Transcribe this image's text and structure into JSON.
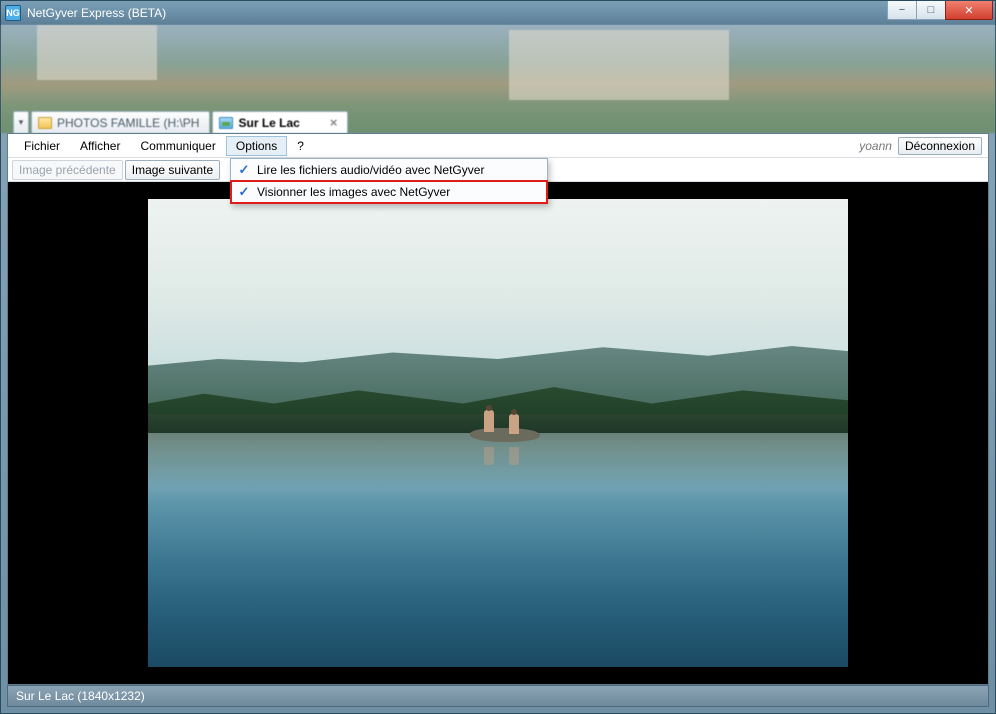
{
  "window": {
    "title": "NetGyver Express (BETA)",
    "app_icon_text": "NG"
  },
  "tabs": {
    "dropdown_glyph": "▾",
    "items": [
      {
        "label": "PHOTOS FAMILLE (H:\\PH",
        "icon": "folder",
        "active": false
      },
      {
        "label": "Sur Le Lac",
        "icon": "image",
        "active": true,
        "close_glyph": "×"
      }
    ]
  },
  "menu": {
    "items": [
      {
        "label": "Fichier"
      },
      {
        "label": "Afficher"
      },
      {
        "label": "Communiquer"
      },
      {
        "label": "Options",
        "open": true
      },
      {
        "label": "?"
      }
    ],
    "username": "yoann",
    "logout_label": "Déconnexion"
  },
  "toolbar": {
    "prev_label": "Image précédente",
    "next_label": "Image suivante"
  },
  "options_dropdown": {
    "items": [
      {
        "checked": true,
        "label": "Lire les fichiers audio/vidéo avec NetGyver",
        "highlight": false
      },
      {
        "checked": true,
        "label": "Visionner les images avec NetGyver",
        "highlight": true
      }
    ],
    "check_glyph": "✓"
  },
  "statusbar": {
    "text": "Sur Le Lac (1840x1232)"
  },
  "window_controls": {
    "minimize_glyph": "−",
    "maximize_glyph": "□",
    "close_glyph": "✕"
  }
}
